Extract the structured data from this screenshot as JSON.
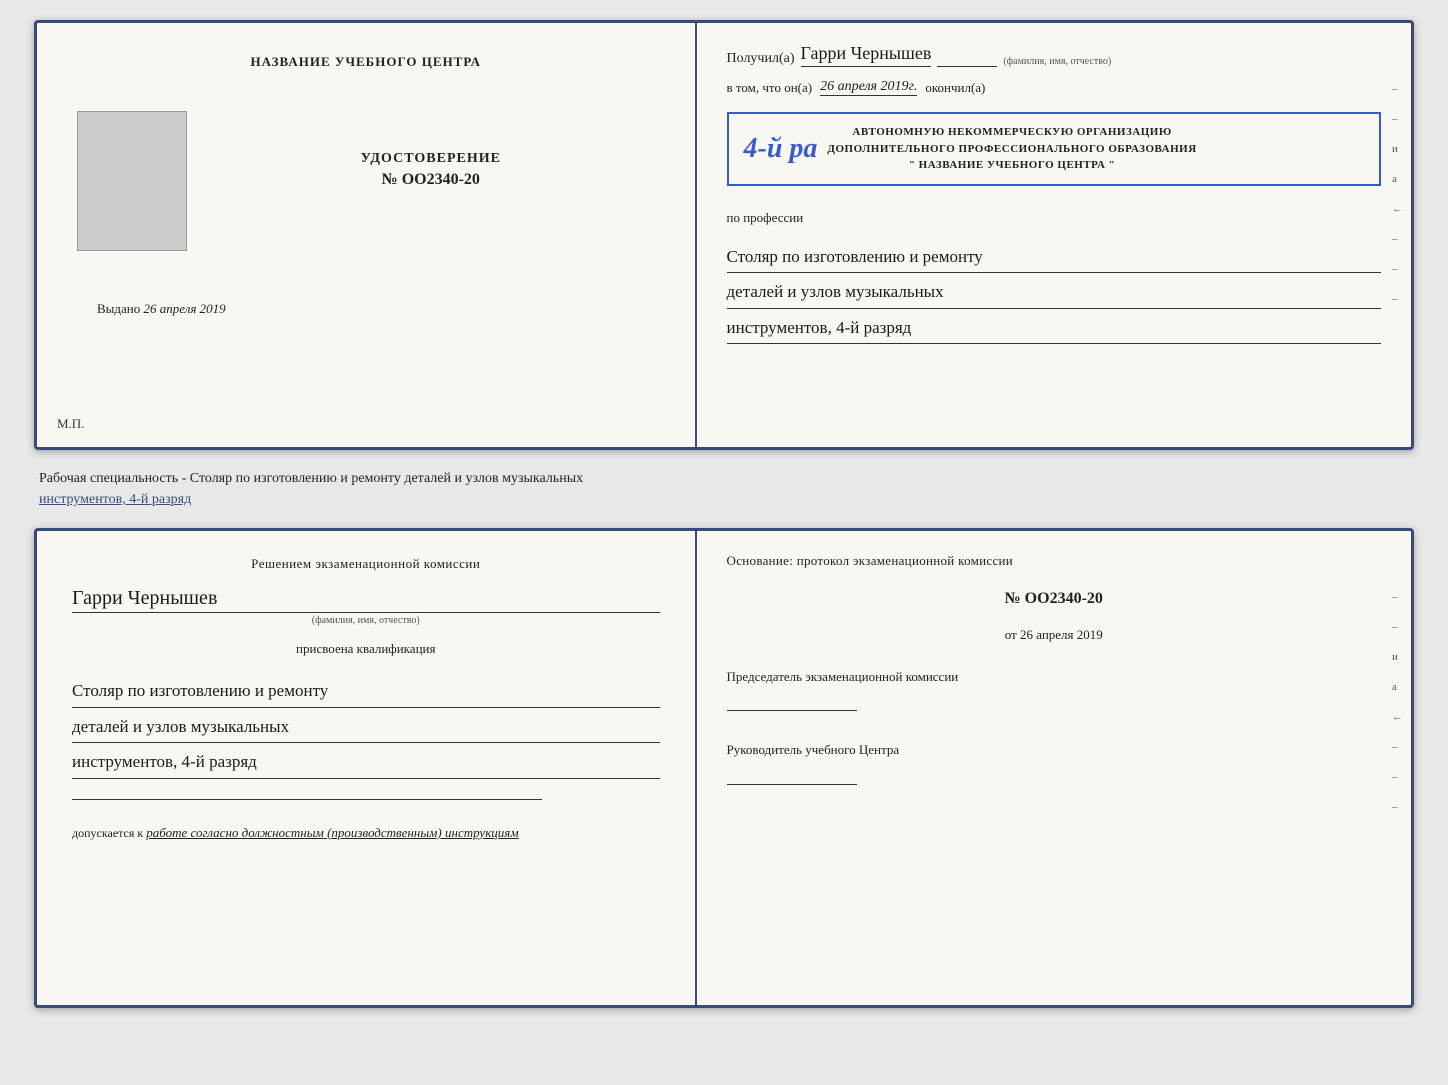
{
  "top_doc": {
    "left": {
      "title": "НАЗВАНИЕ УЧЕБНОГО ЦЕНТРА",
      "photo_alt": "фото",
      "udost_label": "УДОСТОВЕРЕНИЕ",
      "udost_number": "№ OO2340-20",
      "vydano_label": "Выдано",
      "vydano_date": "26 апреля 2019",
      "mp": "М.П."
    },
    "right": {
      "poluchil_label": "Получил(а)",
      "poluchil_name": "Гарри Чернышев",
      "fio_hint": "(фамилия, имя, отчество)",
      "vtom_label": "в том, что он(а)",
      "vtom_date": "26 апреля 2019г.",
      "okonchil_label": "окончил(а)",
      "stamp_4y": "4-й рa",
      "stamp_line1": "АВТОНОМНУЮ НЕКОММЕРЧЕСКУЮ ОРГАНИЗАЦИЮ",
      "stamp_line2": "ДОПОЛНИТЕЛЬНОГО ПРОФЕССИОНАЛЬНОГО ОБРАЗОВАНИЯ",
      "stamp_line3": "\" НАЗВАНИЕ УЧЕБНОГО ЦЕНТРА \"",
      "po_professii": "по профессии",
      "profession_line1": "Столяр по изготовлению и ремонту",
      "profession_line2": "деталей и узлов музыкальных",
      "profession_line3": "инструментов, 4-й разряд"
    }
  },
  "caption": {
    "text": "Рабочая специальность - Столяр по изготовлению и ремонту деталей и узлов музыкальных",
    "text2": "инструментов, 4-й разряд"
  },
  "bottom_doc": {
    "left": {
      "resheniem": "Решением  экзаменационной  комиссии",
      "name": "Гарри Чернышев",
      "fio_hint": "(фамилия, имя, отчество)",
      "prisvoena": "присвоена квалификация",
      "qualification_line1": "Столяр по изготовлению и ремонту",
      "qualification_line2": "деталей и узлов музыкальных",
      "qualification_line3": "инструментов, 4-й разряд",
      "dopuskaetsya": "допускается к",
      "dopusk_italic": "работе согласно должностным (производственным) инструкциям"
    },
    "right": {
      "osnovanie": "Основание: протокол экзаменационной  комиссии",
      "number": "№  OO2340-20",
      "ot_label": "от",
      "ot_date": "26 апреля 2019",
      "predsedatel_label": "Председатель экзаменационной комиссии",
      "rukovoditel_label": "Руководитель учебного Центра"
    }
  },
  "decorations": {
    "right_chars": [
      "–",
      "–",
      "и",
      "а",
      "←",
      "–",
      "–",
      "–",
      "–"
    ]
  }
}
